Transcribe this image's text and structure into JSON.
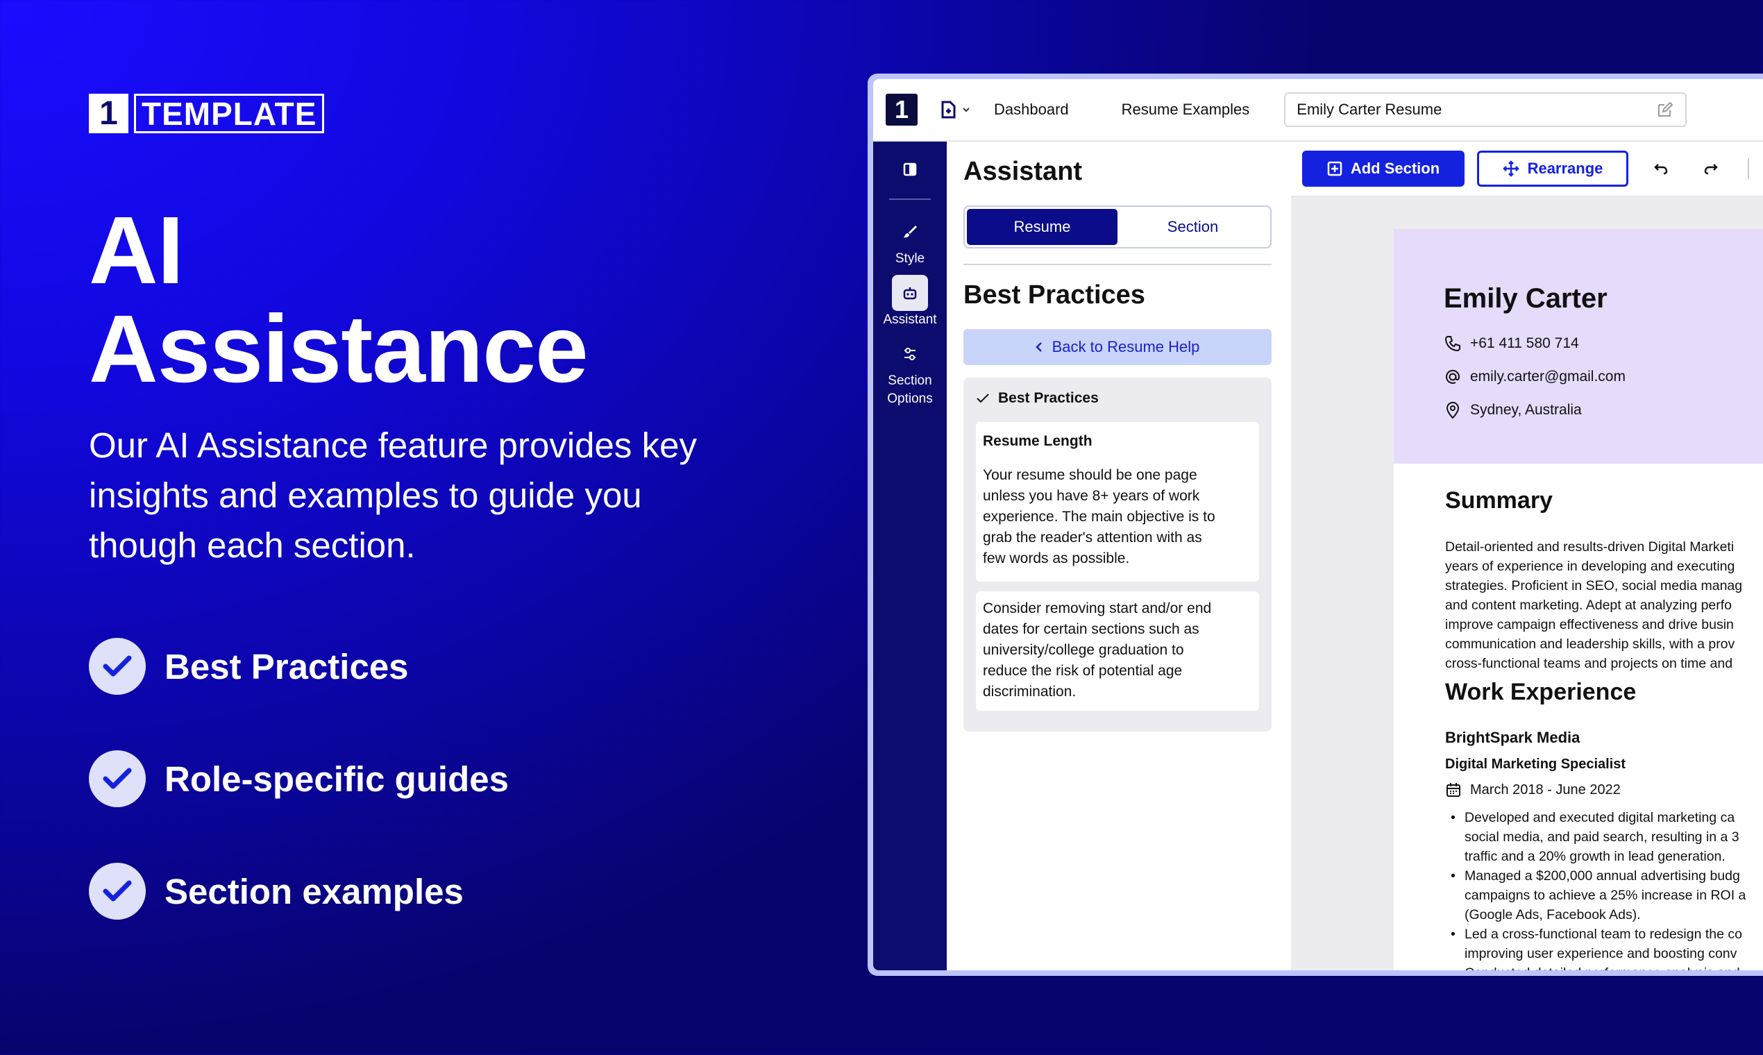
{
  "hero": {
    "logo_number": "1",
    "logo_word": "TEMPLATE",
    "title_line1": "AI",
    "title_line2": "Assistance",
    "description_line1": "Our AI Assistance feature provides key",
    "description_line2": "insights and examples to guide you",
    "description_line3": "though each section.",
    "features": [
      "Best Practices",
      "Role-specific guides",
      "Section examples"
    ]
  },
  "app": {
    "logo": "1",
    "nav": [
      "Dashboard",
      "Resume Examples"
    ],
    "doc_title": "Emily Carter Resume",
    "sidebar": {
      "items": [
        {
          "label": "Style",
          "icon": "paintbrush-icon"
        },
        {
          "label": "Assistant",
          "icon": "robot-icon"
        },
        {
          "label_line1": "Section",
          "label_line2": "Options",
          "icon": "sliders-icon"
        }
      ]
    },
    "panel": {
      "title": "Assistant",
      "tabs": [
        "Resume",
        "Section"
      ],
      "active_tab": "Resume",
      "subtitle": "Best Practices",
      "back_label": "Back to Resume Help",
      "tips_heading": "Best Practices",
      "tip1_title": "Resume Length",
      "tip1_body": [
        "Your resume should be one page",
        "unless you have 8+ years of work",
        "experience. The main objective is to",
        "grab the reader's attention with as",
        "few words as possible."
      ],
      "tip2_body": [
        "Consider removing start and/or end",
        "dates for certain sections such as",
        "university/college graduation to",
        "reduce the risk of potential age",
        "discrimination."
      ]
    },
    "toolbar": {
      "add_section": "Add Section",
      "rearrange": "Rearrange"
    },
    "resume": {
      "name": "Emily Carter",
      "phone": "+61 411 580 714",
      "email": "emily.carter@gmail.com",
      "location": "Sydney, Australia",
      "summary_title": "Summary",
      "summary_lines": [
        "Detail-oriented and results-driven Digital Marketi",
        "years of experience in developing and executing",
        "strategies. Proficient in SEO, social media manag",
        "and content marketing. Adept at analyzing perfo",
        "improve campaign effectiveness and drive busin",
        "communication and leadership skills, with a prov",
        "cross-functional teams and projects on time and"
      ],
      "work_title": "Work Experience",
      "company": "BrightSpark Media",
      "role": "Digital Marketing Specialist",
      "dates": "March 2018 - June 2022",
      "bullets": [
        [
          "Developed and executed digital marketing ca",
          "social media, and paid search, resulting in a 3",
          "traffic and a 20% growth in lead generation."
        ],
        [
          "Managed a $200,000 annual advertising budg",
          "campaigns to achieve a 25% increase in ROI a",
          "(Google Ads, Facebook Ads)."
        ],
        [
          "Led a cross-functional team to redesign the co",
          "improving user experience and boosting conv"
        ],
        [
          "Conducted detailed performance analysis and"
        ]
      ]
    }
  },
  "colors": {
    "background": "#1208e0",
    "sidebar": "#0b0c6e",
    "primary_button": "#1422e0",
    "resume_header": "#e6dbfb",
    "check_circle": "#dfe1fb"
  }
}
